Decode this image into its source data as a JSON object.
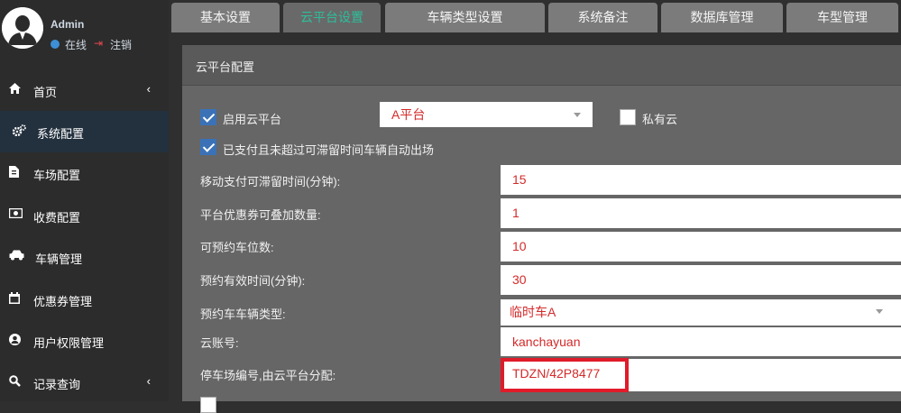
{
  "user": {
    "name": "Admin",
    "status": "在线",
    "logout": "注销"
  },
  "sidebar": {
    "items": [
      {
        "label": "首页",
        "icon": "home-icon",
        "chevron": "‹"
      },
      {
        "label": "系统配置",
        "icon": "cogs-icon"
      },
      {
        "label": "车场配置",
        "icon": "document-icon"
      },
      {
        "label": "收费配置",
        "icon": "money-icon"
      },
      {
        "label": "车辆管理",
        "icon": "car-icon"
      },
      {
        "label": "优惠券管理",
        "icon": "calendar-icon"
      },
      {
        "label": "用户权限管理",
        "icon": "user-icon"
      },
      {
        "label": "记录查询",
        "icon": "search-icon",
        "chevron": "‹"
      }
    ]
  },
  "tabs": [
    {
      "label": "基本设置"
    },
    {
      "label": "云平台设置"
    },
    {
      "label": "车辆类型设置"
    },
    {
      "label": "系统备注"
    },
    {
      "label": "数据库管理"
    },
    {
      "label": "车型管理"
    }
  ],
  "panel": {
    "title": "云平台配置",
    "enable_cloud": {
      "label": "启用云平台",
      "checked": true
    },
    "platform_select": {
      "value": "A平台"
    },
    "private_cloud": {
      "label": "私有云",
      "checked": false
    },
    "auto_exit": {
      "label": "已支付且未超过可滞留时间车辆自动出场",
      "checked": true
    },
    "fields": [
      {
        "label": "移动支付可滞留时间(分钟):",
        "value": "15"
      },
      {
        "label": "平台优惠券可叠加数量:",
        "value": "1"
      },
      {
        "label": "可预约车位数:",
        "value": "10"
      },
      {
        "label": "预约有效时间(分钟):",
        "value": "30"
      },
      {
        "label": "预约车车辆类型:",
        "value": "临时车A"
      },
      {
        "label": "云账号:",
        "value": "kanchayuan"
      },
      {
        "label": "停车场编号,由云平台分配:",
        "value": "TDZN/42P8477"
      }
    ]
  },
  "colors": {
    "accent_tab": "#2dbe9b",
    "value_text": "#d42a2a",
    "highlight": "#e01b2a",
    "checkbox": "#3b72b7"
  }
}
